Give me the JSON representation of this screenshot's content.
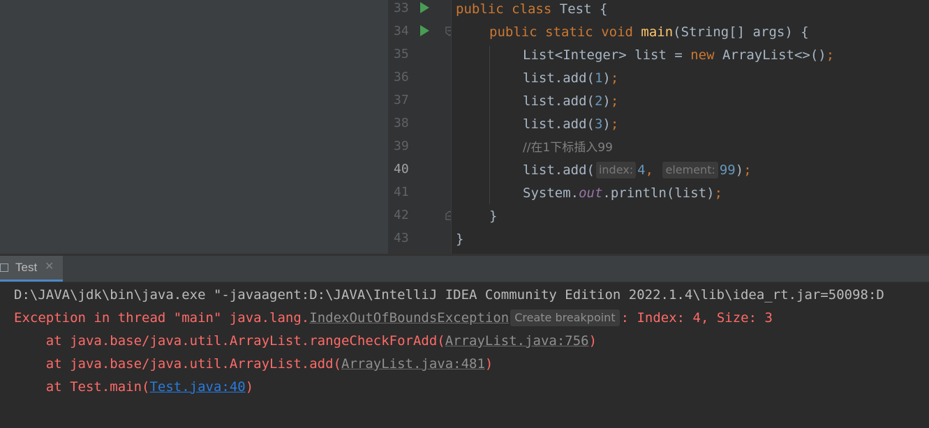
{
  "editor": {
    "gutter": {
      "line_numbers": [
        "33",
        "34",
        "35",
        "36",
        "37",
        "38",
        "39",
        "40",
        "41",
        "42",
        "43"
      ],
      "current_line": "40"
    },
    "code": {
      "l33": {
        "kw1": "public",
        "kw2": "class",
        "rest": "Test {"
      },
      "l34": {
        "kw1": "public",
        "kw2": "static",
        "kw3": "void",
        "method": "main",
        "rest": "(String[] args) {"
      },
      "l35": {
        "pre": "List<Integer> list = ",
        "kw": "new",
        "mid": "ArrayList<>()",
        "semi": ";"
      },
      "l36": {
        "pre": "list.add(",
        "num": "1",
        "post": ")",
        "semi": ";"
      },
      "l37": {
        "pre": "list.add(",
        "num": "2",
        "post": ")",
        "semi": ";"
      },
      "l38": {
        "pre": "list.add(",
        "num": "3",
        "post": ")",
        "semi": ";"
      },
      "l39": {
        "comment": "//在1下标插入99"
      },
      "l40": {
        "pre": "list.add(",
        "hint_index": "index:",
        "num1": "4",
        "comma": ",",
        "hint_element": "element:",
        "num2": "99",
        "post": ")",
        "semi": ";"
      },
      "l41": {
        "pre": "System.",
        "field": "out",
        "mid": ".println(list)",
        "semi": ";"
      },
      "l42": {
        "text": "}"
      },
      "l43": {
        "text": "}"
      }
    }
  },
  "run_panel": {
    "tab_label": "Test",
    "close_glyph": "✕"
  },
  "console": {
    "command": "D:\\JAVA\\jdk\\bin\\java.exe \"-javaagent:D:\\JAVA\\IntelliJ IDEA Community Edition 2022.1.4\\lib\\idea_rt.jar=50098:D",
    "exception": {
      "prefix": "Exception in thread \"main\" java.lang.",
      "class_link": "IndexOutOfBoundsException",
      "breakpoint_tip": "Create breakpoint",
      "suffix": ": Index: 4, Size: 3"
    },
    "stack": [
      {
        "prefix": "    at java.base/java.util.ArrayList.rangeCheckForAdd(",
        "link": "ArrayList.java:756",
        "suffix": ")"
      },
      {
        "prefix": "    at java.base/java.util.ArrayList.add(",
        "link": "ArrayList.java:481",
        "suffix": ")"
      },
      {
        "prefix": "    at Test.main(",
        "link": "Test.java:40",
        "suffix": ")"
      }
    ]
  },
  "colors": {
    "keyword": "#cc7832",
    "method": "#ffc66d",
    "number": "#6897bb",
    "error": "#ff6b68",
    "link": "#287bde",
    "run_icon": "#499c54"
  },
  "icons": {
    "run": "run-triangle-icon",
    "fold": "fold-marker-icon",
    "tab": "console-tab-icon",
    "close": "close-icon"
  }
}
